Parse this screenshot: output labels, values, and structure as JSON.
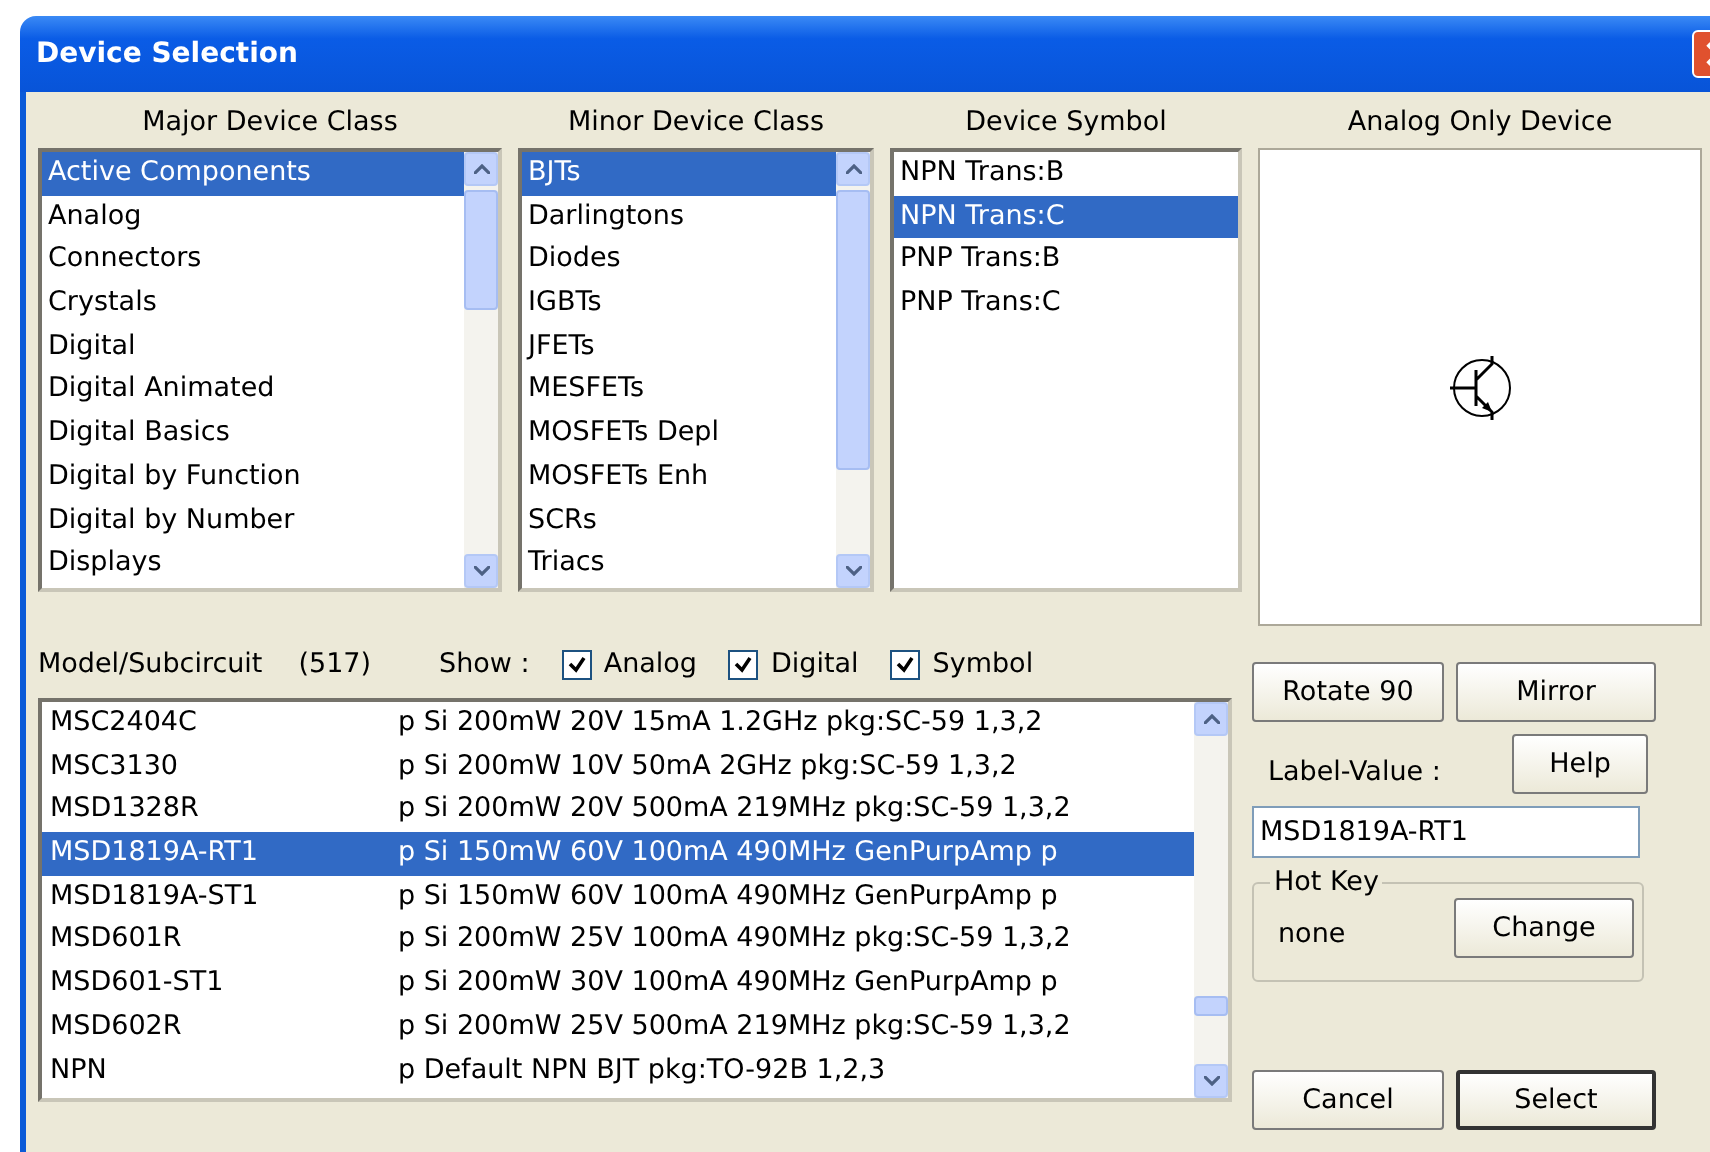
{
  "window": {
    "title": "Device Selection"
  },
  "major_device_class": {
    "heading": "Major Device Class",
    "items": [
      {
        "label": "Active Components",
        "selected": true
      },
      {
        "label": "Analog",
        "selected": false
      },
      {
        "label": "Connectors",
        "selected": false
      },
      {
        "label": "Crystals",
        "selected": false
      },
      {
        "label": "Digital",
        "selected": false
      },
      {
        "label": "Digital Animated",
        "selected": false
      },
      {
        "label": "Digital Basics",
        "selected": false
      },
      {
        "label": "Digital by Function",
        "selected": false
      },
      {
        "label": "Digital by Number",
        "selected": false
      },
      {
        "label": "Displays",
        "selected": false
      }
    ]
  },
  "minor_device_class": {
    "heading": "Minor Device Class",
    "items": [
      {
        "label": "BJTs",
        "selected": true
      },
      {
        "label": "Darlingtons",
        "selected": false
      },
      {
        "label": "Diodes",
        "selected": false
      },
      {
        "label": "IGBTs",
        "selected": false
      },
      {
        "label": "JFETs",
        "selected": false
      },
      {
        "label": "MESFETs",
        "selected": false
      },
      {
        "label": "MOSFETs Depl",
        "selected": false
      },
      {
        "label": "MOSFETs Enh",
        "selected": false
      },
      {
        "label": "SCRs",
        "selected": false
      },
      {
        "label": "Triacs",
        "selected": false
      }
    ]
  },
  "device_symbol": {
    "heading": "Device Symbol",
    "items": [
      {
        "label": "NPN Trans:B",
        "selected": false
      },
      {
        "label": "NPN Trans:C",
        "selected": true
      },
      {
        "label": "PNP Trans:B",
        "selected": false
      },
      {
        "label": "PNP Trans:C",
        "selected": false
      }
    ]
  },
  "preview": {
    "heading": "Analog Only Device"
  },
  "model": {
    "label": "Model/Subcircuit",
    "count": "(517)",
    "show_label": "Show :",
    "filters": [
      {
        "label": "Analog",
        "checked": true
      },
      {
        "label": "Digital",
        "checked": true
      },
      {
        "label": "Symbol",
        "checked": true
      }
    ],
    "rows": [
      {
        "model": "MSC2404C",
        "description": "p Si 200mW 20V 15mA 1.2GHz pkg:SC-59 1,3,2",
        "selected": false
      },
      {
        "model": "MSC3130",
        "description": "p Si 200mW 10V 50mA 2GHz pkg:SC-59 1,3,2",
        "selected": false
      },
      {
        "model": "MSD1328R",
        "description": "p Si 200mW 20V 500mA 219MHz pkg:SC-59 1,3,2",
        "selected": false
      },
      {
        "model": "MSD1819A-RT1",
        "description": "p Si 150mW 60V 100mA 490MHz GenPurpAmp p",
        "selected": true
      },
      {
        "model": "MSD1819A-ST1",
        "description": "p Si 150mW 60V 100mA 490MHz GenPurpAmp p",
        "selected": false
      },
      {
        "model": "MSD601R",
        "description": "p Si 200mW 25V 100mA 490MHz pkg:SC-59 1,3,2",
        "selected": false
      },
      {
        "model": "MSD601-ST1",
        "description": "p Si 200mW 30V 100mA 490MHz GenPurpAmp p",
        "selected": false
      },
      {
        "model": "MSD602R",
        "description": "p Si 200mW 25V 500mA 219MHz pkg:SC-59 1,3,2",
        "selected": false
      },
      {
        "model": "NPN",
        "description": "p Default NPN BJT pkg:TO-92B 1,2,3",
        "selected": false
      }
    ]
  },
  "buttons": {
    "rotate": "Rotate 90",
    "mirror": "Mirror",
    "help": "Help",
    "change": "Change",
    "cancel": "Cancel",
    "select": "Select"
  },
  "label_value": {
    "label": "Label-Value :",
    "value": "MSD1819A-RT1"
  },
  "hot_key": {
    "legend": "Hot Key",
    "value": "none"
  }
}
